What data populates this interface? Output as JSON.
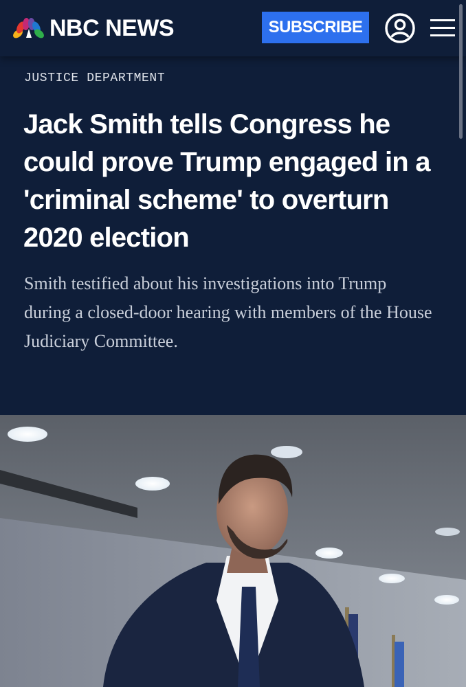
{
  "header": {
    "brand": "NBC NEWS",
    "subscribe_label": "SUBSCRIBE",
    "account_icon": "account-icon",
    "menu_icon": "hamburger-menu-icon"
  },
  "article": {
    "category": "JUSTICE DEPARTMENT",
    "headline": "Jack Smith tells Congress he could prove Trump engaged in a 'criminal scheme' to overturn 2020 election",
    "dek": "Smith testified about his investigations into Trump during a closed-door hearing with members of the House Judiciary Committee."
  },
  "colors": {
    "background": "#0f1e39",
    "subscribe": "#2d70ee",
    "text": "#ffffff",
    "dek": "#c9cfda"
  }
}
